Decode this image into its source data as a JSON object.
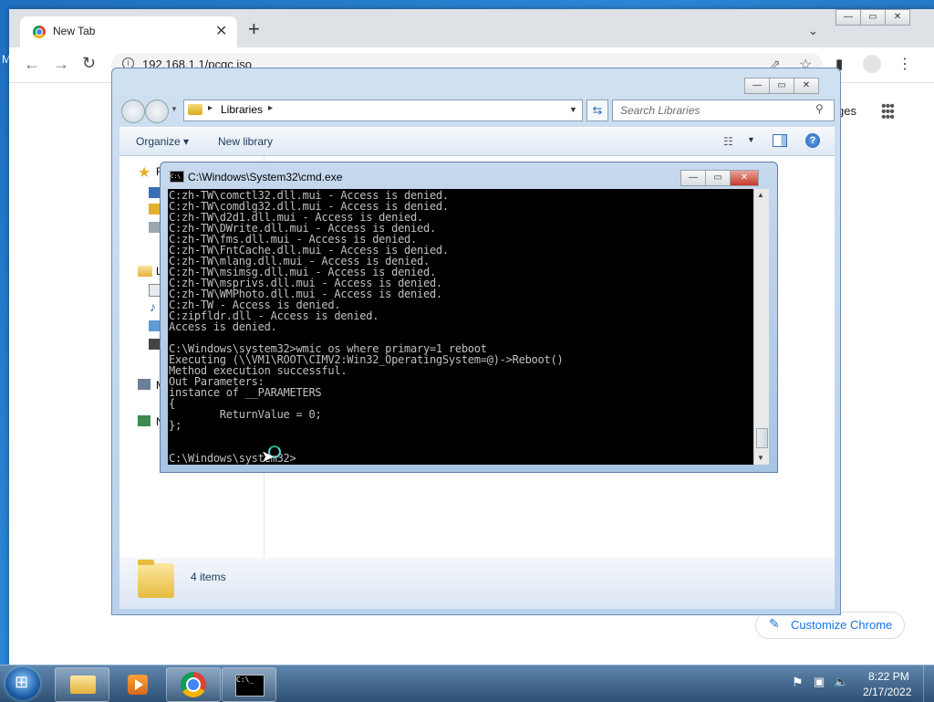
{
  "desktop": {
    "left_edge_letter": "M"
  },
  "chrome": {
    "tab_title": "New Tab",
    "tab_close": "✕",
    "new_tab": "+",
    "tab_menu": "⌄",
    "url": "192.168.1.1/pcgc.iso",
    "partial_shortcut_text": "ges",
    "customize_label": "Customize Chrome",
    "customize_icon": "pencil-icon"
  },
  "explorer": {
    "breadcrumb": "Libraries",
    "search_placeholder": "Search Libraries",
    "organize": "Organize ▾",
    "new_library": "New library",
    "nav_favorites": "F",
    "nav_libraries": "L",
    "nav_network": "N",
    "status_text": "4 items"
  },
  "cmd": {
    "title": "C:\\Windows\\System32\\cmd.exe",
    "lines": [
      "C:zh-TW\\comctl32.dll.mui - Access is denied.",
      "C:zh-TW\\comdlg32.dll.mui - Access is denied.",
      "C:zh-TW\\d2d1.dll.mui - Access is denied.",
      "C:zh-TW\\DWrite.dll.mui - Access is denied.",
      "C:zh-TW\\fms.dll.mui - Access is denied.",
      "C:zh-TW\\FntCache.dll.mui - Access is denied.",
      "C:zh-TW\\mlang.dll.mui - Access is denied.",
      "C:zh-TW\\msimsg.dll.mui - Access is denied.",
      "C:zh-TW\\msprivs.dll.mui - Access is denied.",
      "C:zh-TW\\WMPhoto.dll.mui - Access is denied.",
      "C:zh-TW - Access is denied.",
      "C:zipfldr.dll - Access is denied.",
      "Access is denied.",
      "",
      "C:\\Windows\\system32>wmic os where primary=1 reboot",
      "Executing (\\\\VM1\\ROOT\\CIMV2:Win32_OperatingSystem=@)->Reboot()",
      "Method execution successful.",
      "Out Parameters:",
      "instance of __PARAMETERS",
      "{",
      "        ReturnValue = 0;",
      "};",
      "",
      "",
      "C:\\Windows\\system32>"
    ]
  },
  "taskbar": {
    "clock_time": "8:22 PM",
    "clock_date": "2/17/2022",
    "cmd_icon_text": "C:\\_"
  },
  "window_buttons": {
    "minimize": "—",
    "maximize": "▭",
    "close": "✕"
  }
}
